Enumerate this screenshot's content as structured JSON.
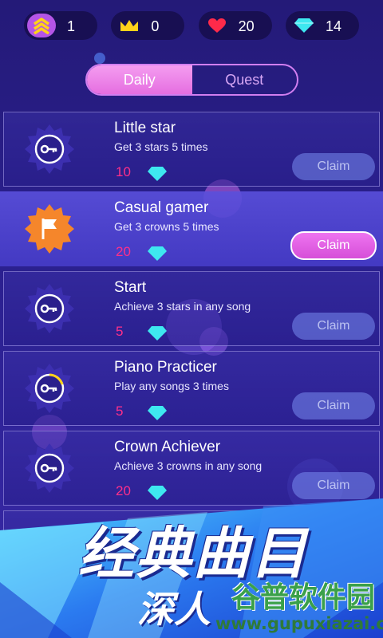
{
  "stats": {
    "level": "1",
    "crowns": "0",
    "lives": "20",
    "gems": "14"
  },
  "tabs": [
    {
      "label": "Daily",
      "active": true
    },
    {
      "label": "Quest",
      "active": false
    }
  ],
  "quests": [
    {
      "title": "Little star",
      "desc": "Get 3 stars 5 times",
      "reward": "10",
      "button": "Claim",
      "claimable": false,
      "badge": "key-icon"
    },
    {
      "title": "Casual gamer",
      "desc": "Get 3 crowns 5 times",
      "reward": "20",
      "button": "Claim",
      "claimable": true,
      "badge": "flag-icon"
    },
    {
      "title": "Start",
      "desc": "Achieve 3 stars in any song",
      "reward": "5",
      "button": "Claim",
      "claimable": false,
      "badge": "key-icon"
    },
    {
      "title": "Piano Practicer",
      "desc": "Play any songs 3 times",
      "reward": "5",
      "button": "Claim",
      "claimable": false,
      "badge": "key-icon"
    },
    {
      "title": "Crown Achiever",
      "desc": "Achieve 3 crowns in any song",
      "reward": "20",
      "button": "Claim",
      "claimable": false,
      "badge": "key-icon"
    }
  ],
  "banner": {
    "title": "经典曲目",
    "subtitle": "深人",
    "watermark_title": "谷普软件园",
    "watermark_url": "www.gupuxiazai.com"
  },
  "colors": {
    "accent_pink": "#e56ee0",
    "reward_text": "#ff2f8a",
    "gem": "#3ee8f0",
    "heart": "#ff2a4a",
    "crown": "#ffd21a"
  }
}
